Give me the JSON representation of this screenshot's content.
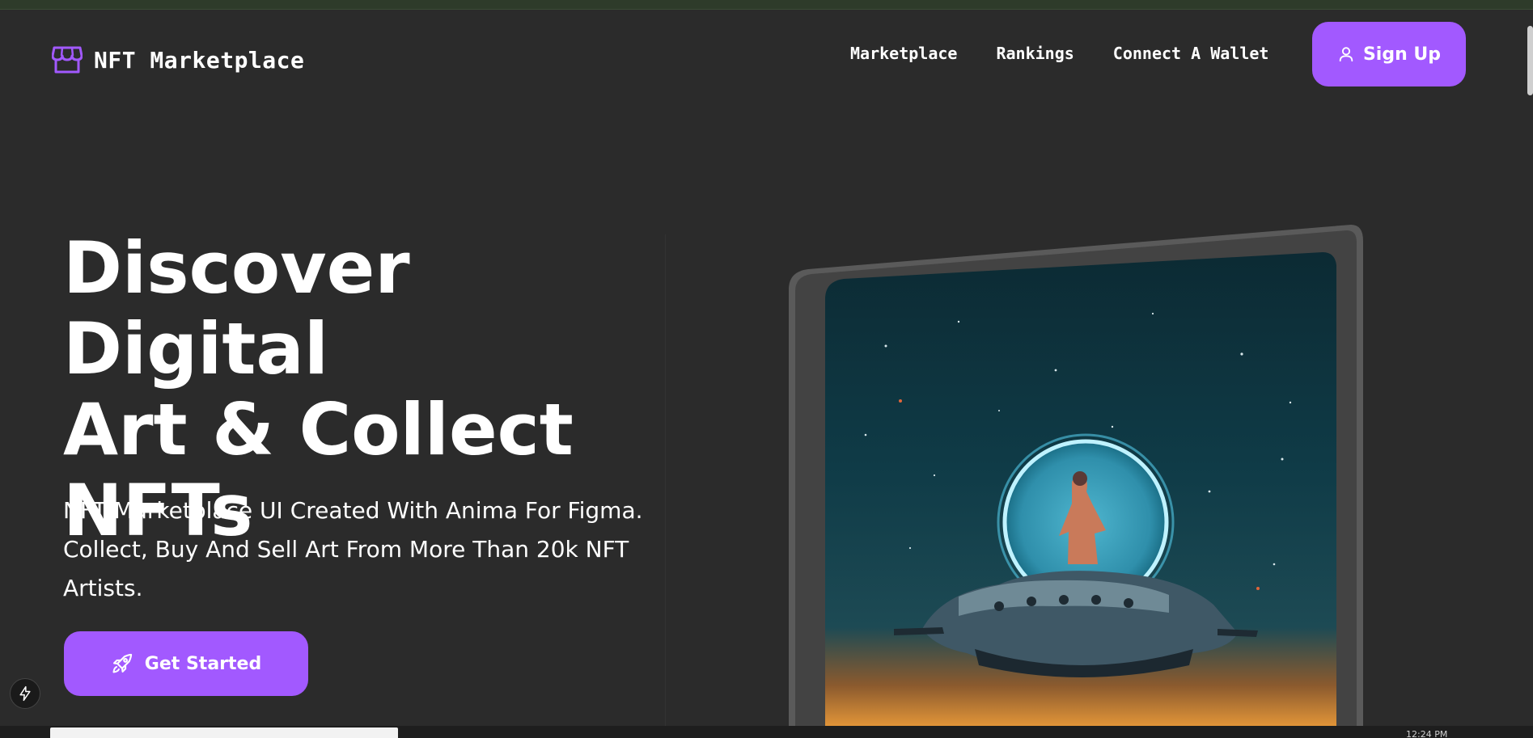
{
  "header": {
    "logo_text": "NFT Marketplace",
    "logo_icon": "storefront-icon",
    "nav": [
      {
        "label": "Marketplace"
      },
      {
        "label": "Rankings"
      },
      {
        "label": "Connect A Wallet"
      }
    ],
    "signup_label": "Sign Up",
    "signup_icon": "user-icon"
  },
  "hero": {
    "title_line1": "Discover Digital",
    "title_line2": "Art & Collect",
    "title_line3": "NFTs",
    "subtitle": "NFT Marketplace UI Created With Anima For Figma. Collect, Buy And Sell Art From More Than 20k NFT Artists.",
    "cta_label": "Get Started",
    "cta_icon": "rocket-icon",
    "art_image": "astronaut-planet-artwork"
  },
  "taskbar": {
    "clock": "12:24 PM"
  },
  "colors": {
    "background": "#2b2b2b",
    "accent": "#a259ff",
    "text": "#ffffff"
  }
}
